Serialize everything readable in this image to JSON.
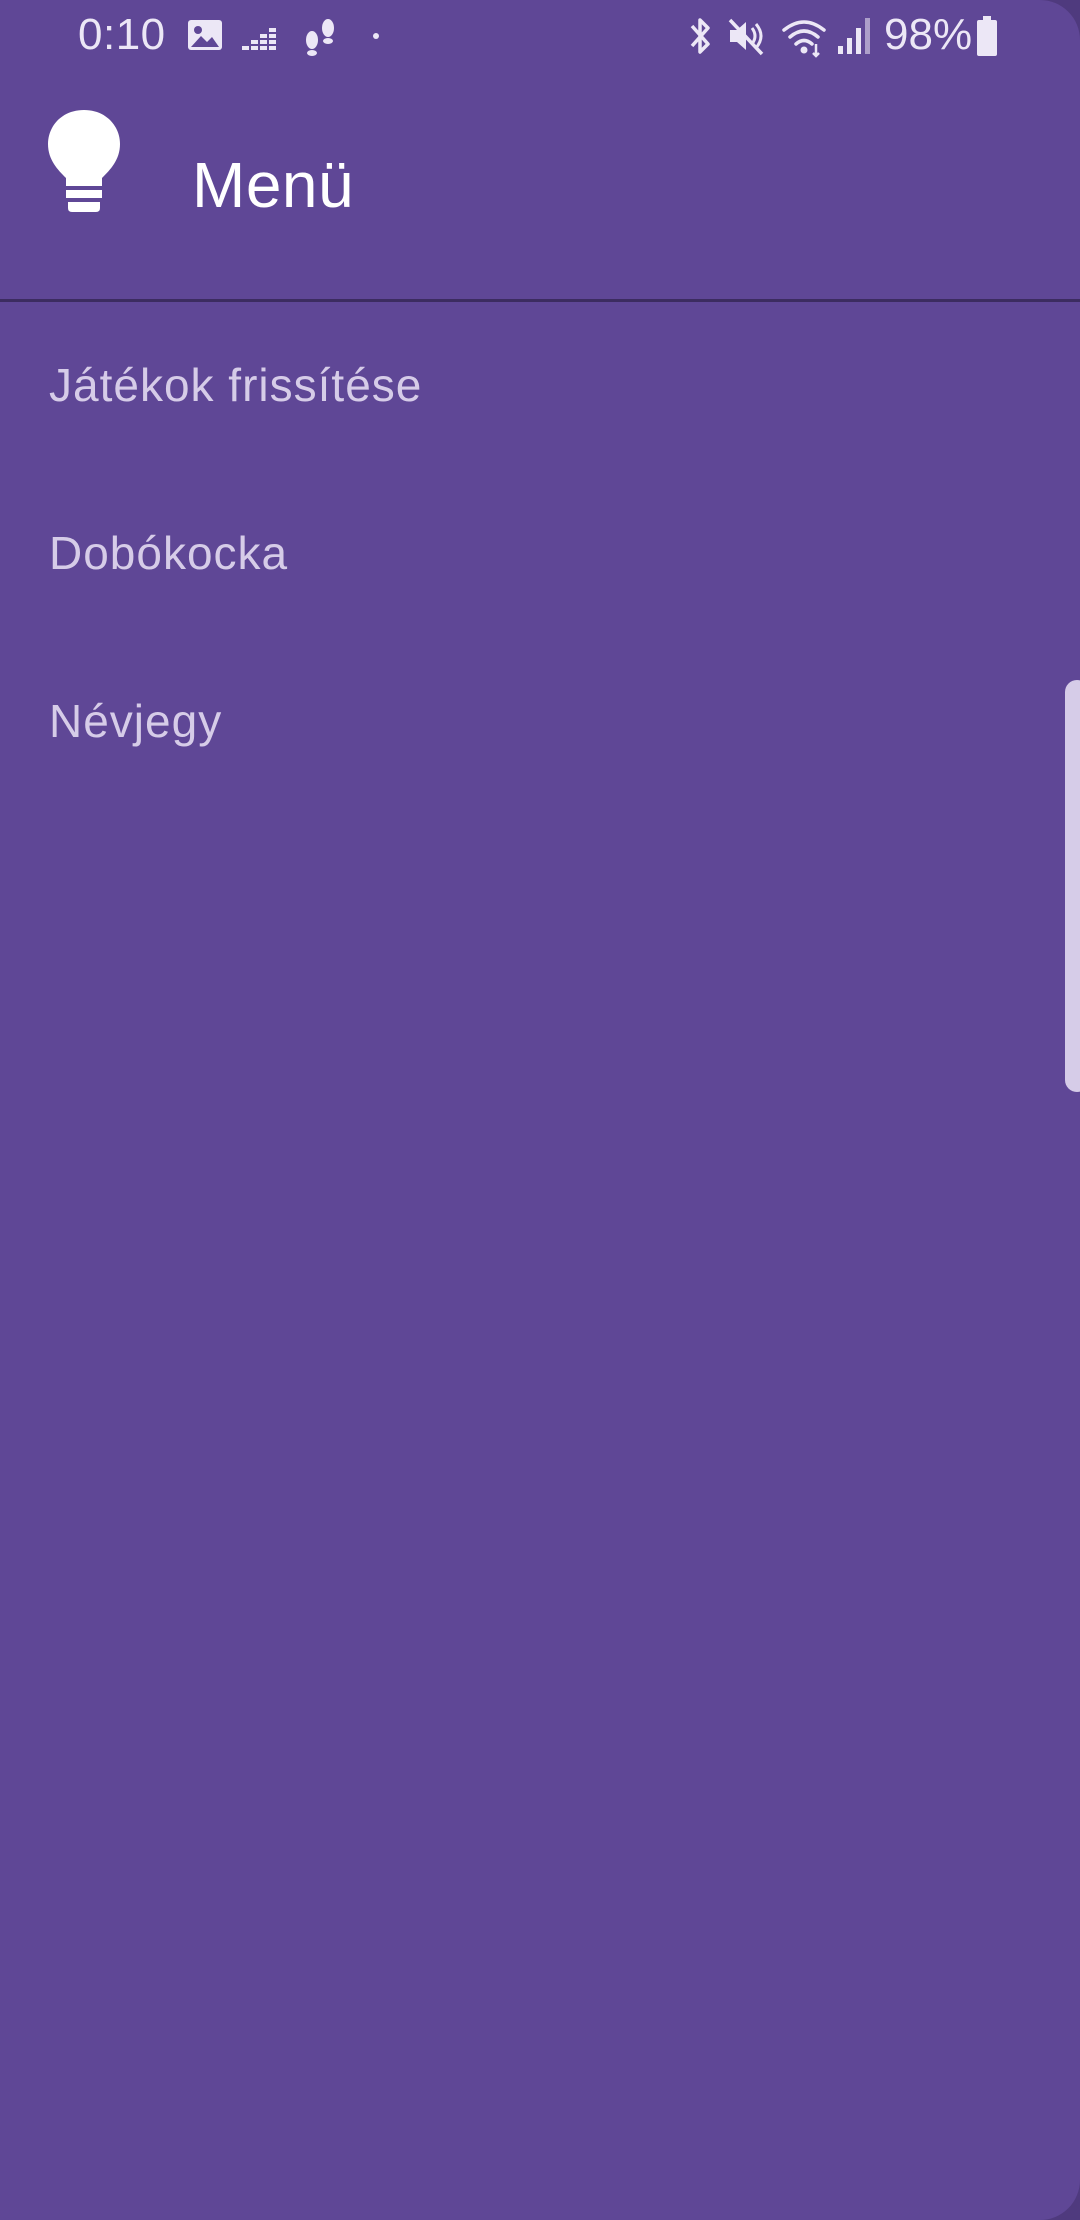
{
  "status_bar": {
    "time": "0:10",
    "battery_percent": "98%",
    "left_icons": [
      "image-icon",
      "deezer-icon",
      "footsteps-icon",
      "dot-icon"
    ],
    "right_icons": [
      "bluetooth-icon",
      "mute-icon",
      "wifi-icon",
      "signal-icon",
      "battery-icon"
    ]
  },
  "drawer": {
    "header": {
      "icon": "lightbulb-icon",
      "title": "Menü"
    },
    "items": [
      {
        "label": "Játékok frissítése"
      },
      {
        "label": "Dobókocka"
      },
      {
        "label": "Névjegy"
      }
    ]
  },
  "colors": {
    "drawer_background": "#5f4796",
    "outer_background": "#4f3a7e",
    "menu_text": "#d6cce8",
    "title_text": "#ffffff",
    "divider": "#3c2c60"
  }
}
